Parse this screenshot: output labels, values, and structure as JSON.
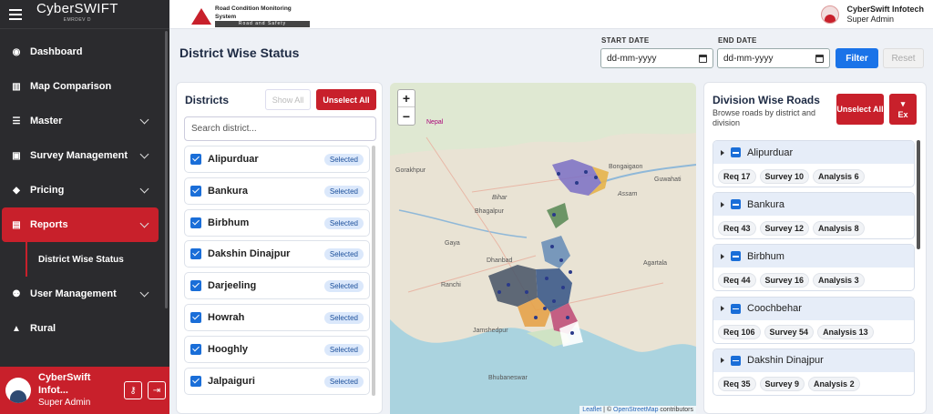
{
  "sidebar": {
    "logo": "CyberSWIFT",
    "logo_sub": "EMRDEV D",
    "items": [
      {
        "label": "Dashboard",
        "icon": "dashboard-icon"
      },
      {
        "label": "Map Comparison",
        "icon": "map-icon"
      },
      {
        "label": "Master",
        "icon": "database-icon"
      },
      {
        "label": "Survey Management",
        "icon": "clipboard-icon"
      },
      {
        "label": "Pricing",
        "icon": "tag-icon"
      },
      {
        "label": "Reports",
        "icon": "chart-icon"
      },
      {
        "label": "User Management",
        "icon": "users-icon"
      },
      {
        "label": "Rural",
        "icon": "road-icon"
      }
    ],
    "active_sub": "District Wise Status",
    "user": {
      "name": "CyberSwift Infot...",
      "role": "Super Admin"
    }
  },
  "topbar": {
    "brand_title": "Road Condition Monitoring System",
    "brand_sub": "Road and Safety",
    "user_name": "CyberSwift Infotech",
    "user_role": "Super Admin"
  },
  "header": {
    "title": "District Wise Status",
    "start_label": "START DATE",
    "end_label": "END DATE",
    "start_placeholder": "dd-mm-yyyy",
    "end_placeholder": "dd-mm-yyyy",
    "filter": "Filter",
    "reset": "Reset"
  },
  "districts": {
    "title": "Districts",
    "show_all": "Show All",
    "unselect_all": "Unselect All",
    "search_placeholder": "Search district...",
    "badge": "Selected",
    "items": [
      "Alipurduar",
      "Bankura",
      "Birbhum",
      "Dakshin Dinajpur",
      "Darjeeling",
      "Howrah",
      "Hooghly",
      "Jalpaiguri"
    ]
  },
  "map": {
    "zoom_in": "+",
    "zoom_out": "−",
    "attribution_leaflet": "Leaflet",
    "attribution_sep": " | © ",
    "attribution_osm": "OpenStreetMap",
    "attribution_tail": " contributors",
    "labels": [
      "Gorakhpur",
      "Bihar",
      "Bhagalpur",
      "Dhanbad",
      "Jamshedpur",
      "Bhubaneswar",
      "Bongaigaon",
      "Guwahati",
      "Assam",
      "Agartala",
      "Gaya",
      "Ranchi",
      "Nepal"
    ]
  },
  "divisions": {
    "title": "Division Wise Roads",
    "subtitle": "Browse roads by district and division",
    "unselect_all": "Unselect All",
    "export_icon": "▾",
    "export_label": "Ex",
    "items": [
      {
        "name": "Alipurduar",
        "req": "Req 17",
        "survey": "Survey 10",
        "analysis": "Analysis 6"
      },
      {
        "name": "Bankura",
        "req": "Req 43",
        "survey": "Survey 12",
        "analysis": "Analysis 8"
      },
      {
        "name": "Birbhum",
        "req": "Req 44",
        "survey": "Survey 16",
        "analysis": "Analysis 3"
      },
      {
        "name": "Coochbehar",
        "req": "Req 106",
        "survey": "Survey 54",
        "analysis": "Analysis 13"
      },
      {
        "name": "Dakshin Dinajpur",
        "req": "Req 35",
        "survey": "Survey 9",
        "analysis": "Analysis 2"
      }
    ]
  }
}
